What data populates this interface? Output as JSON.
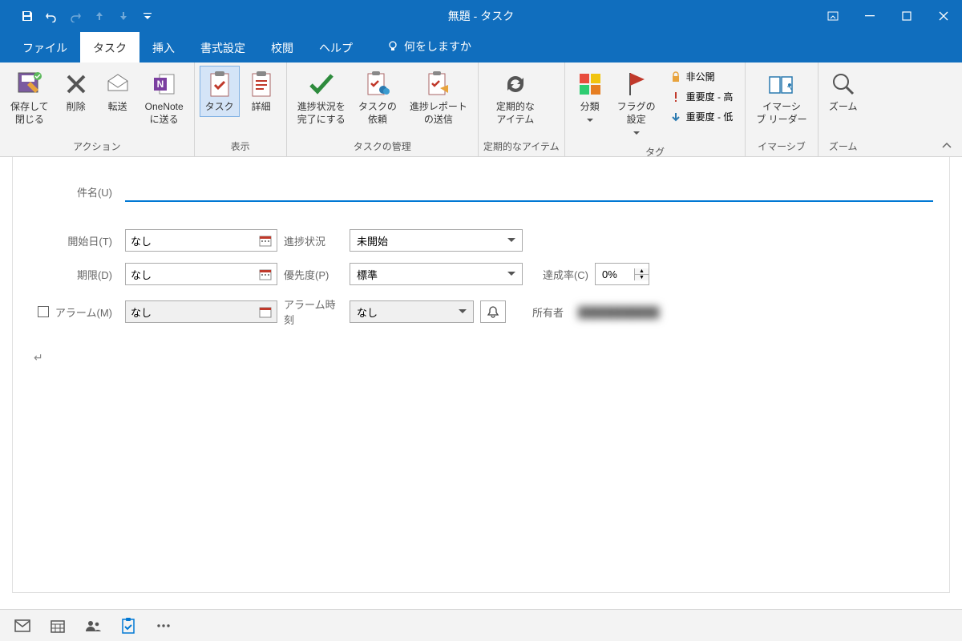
{
  "window": {
    "title": "無題 - タスク"
  },
  "tabs": {
    "file": "ファイル",
    "task": "タスク",
    "insert": "挿入",
    "format": "書式設定",
    "review": "校閲",
    "help": "ヘルプ",
    "tellme": "何をしますか"
  },
  "ribbon": {
    "groups": {
      "actions": {
        "label": "アクション",
        "save_close": "保存して\n閉じる",
        "delete": "削除",
        "forward": "転送",
        "onenote": "OneNote\nに送る"
      },
      "show": {
        "label": "表示",
        "task": "タスク",
        "details": "詳細"
      },
      "manage": {
        "label": "タスクの管理",
        "mark_complete": "進捗状況を\n完了にする",
        "assign": "タスクの\n依頼",
        "send_status": "進捗レポート\nの送信"
      },
      "recurrence": {
        "label": "定期的なアイテム",
        "recurrence": "定期的な\nアイテム"
      },
      "tags": {
        "label": "タグ",
        "categorize": "分類",
        "follow_up": "フラグの\n設定",
        "private": "非公開",
        "high": "重要度 - 高",
        "low": "重要度 - 低"
      },
      "immersive": {
        "label": "イマーシブ",
        "reader": "イマーシ\nブ リーダー"
      },
      "zoom": {
        "label": "ズーム",
        "zoom": "ズーム"
      }
    }
  },
  "form": {
    "subject_label": "件名(U)",
    "subject_value": "",
    "start_date_label": "開始日(T)",
    "start_date_value": "なし",
    "due_date_label": "期限(D)",
    "due_date_value": "なし",
    "status_label": "進捗状況",
    "status_value": "未開始",
    "priority_label": "優先度(P)",
    "priority_value": "標準",
    "complete_label": "達成率(C)",
    "complete_value": "0%",
    "reminder_label": "アラーム(M)",
    "reminder_date_value": "なし",
    "reminder_time_label": "アラーム時刻",
    "reminder_time_value": "なし",
    "owner_label": "所有者",
    "owner_value": "███████████"
  }
}
